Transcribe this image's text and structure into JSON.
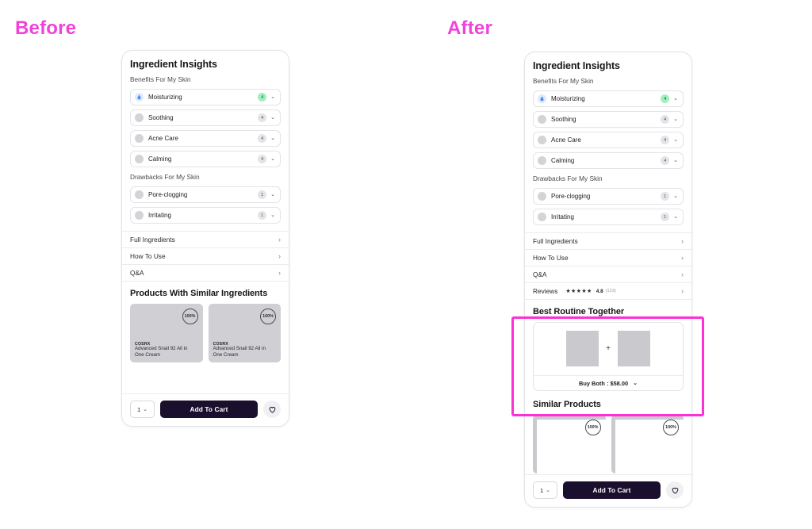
{
  "labels": {
    "before": "Before",
    "after": "After"
  },
  "accent_pink": "#f241d9",
  "highlight_color": "#ff2fd6",
  "insights": {
    "title": "Ingredient Insights",
    "benefits_heading": "Benefits For My Skin",
    "drawbacks_heading": "Drawbacks For My Skin",
    "benefits": [
      {
        "name": "Moisturizing",
        "count": "4",
        "icon": "water-drop-icon",
        "highlighted": true
      },
      {
        "name": "Soothing",
        "count": "4",
        "icon": "dot-icon",
        "highlighted": false
      },
      {
        "name": "Acne Care",
        "count": "4",
        "icon": "dot-icon",
        "highlighted": false
      },
      {
        "name": "Calming",
        "count": "4",
        "icon": "dot-icon",
        "highlighted": false
      }
    ],
    "drawbacks": [
      {
        "name": "Pore-clogging",
        "count": "1",
        "icon": "dot-icon",
        "highlighted": false
      },
      {
        "name": "Irritating",
        "count": "1",
        "icon": "dot-icon",
        "highlighted": false
      }
    ]
  },
  "links_before": [
    {
      "label": "Full Ingredients"
    },
    {
      "label": "How To Use"
    },
    {
      "label": "Q&A"
    }
  ],
  "links_after": [
    {
      "label": "Full Ingredients"
    },
    {
      "label": "How To Use"
    },
    {
      "label": "Q&A"
    },
    {
      "label": "Reviews",
      "stars": "★★★★★",
      "rating": "4.8",
      "count": "(123)"
    }
  ],
  "similar_before": {
    "title": "Products With Similar Ingredients",
    "cards": [
      {
        "pct": "100%",
        "brand": "COSRX",
        "name": "Advanced Snail 92 All in One Cream"
      },
      {
        "pct": "100%",
        "brand": "COSRX",
        "name": "Advanced Snail 92 All in One Cream"
      }
    ]
  },
  "bundle": {
    "title": "Best Routine Together",
    "plus": "+",
    "buy_label": "Buy Both : $58.00"
  },
  "similar_after": {
    "title": "Similar Products",
    "cards": [
      {
        "pct": "100%"
      },
      {
        "pct": "100%"
      }
    ]
  },
  "bottombar": {
    "qty": "1",
    "add_to_cart": "Add To Cart",
    "chevron": "⌄"
  },
  "icons": {
    "chevron_down": "⌄",
    "chevron_right": "›"
  }
}
